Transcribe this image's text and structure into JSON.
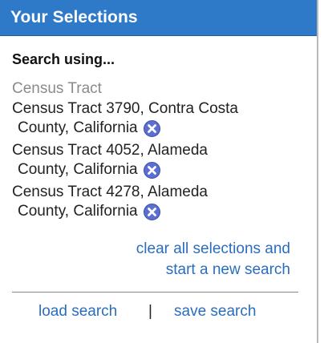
{
  "header": {
    "title": "Your Selections"
  },
  "search_using": "Search using...",
  "category": "Census Tract",
  "selections": [
    {
      "line1": "Census Tract 3790, Contra Costa",
      "line2": "County, California"
    },
    {
      "line1": "Census Tract 4052, Alameda",
      "line2": "County, California"
    },
    {
      "line1": "Census Tract 4278, Alameda",
      "line2": "County, California"
    }
  ],
  "clear_link": {
    "line1": "clear all selections and",
    "line2": "start a new search"
  },
  "footer": {
    "load": "load search",
    "separator": "|",
    "save": "save search"
  },
  "icons": {
    "remove": "remove-icon"
  },
  "colors": {
    "header_bg": "#2f79c9",
    "link": "#2a6dbd",
    "remove_icon": "#5b6fd0"
  }
}
